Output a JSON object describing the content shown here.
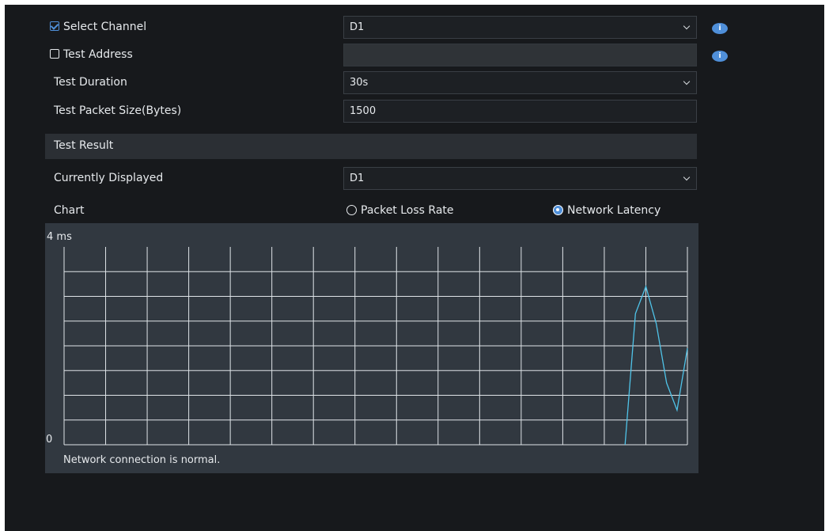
{
  "form": {
    "select_channel_label": "Select Channel",
    "select_channel_checked": true,
    "select_channel_value": "D1",
    "test_address_label": "Test Address",
    "test_address_checked": false,
    "test_address_value": "",
    "test_duration_label": "Test Duration",
    "test_duration_value": "30s",
    "packet_size_label": "Test Packet Size(Bytes)",
    "packet_size_value": "1500",
    "info_icon": "info-icon"
  },
  "result": {
    "section_title": "Test Result",
    "currently_displayed_label": "Currently Displayed",
    "currently_displayed_value": "D1",
    "chart_label": "Chart",
    "option_loss": "Packet Loss Rate",
    "option_latency": "Network Latency",
    "selected_option": "Network Latency",
    "status_text": "Network connection is normal."
  },
  "colors": {
    "accent": "#4f8fd9",
    "line": "#4fc3e8",
    "grid": "#dfe4e8",
    "panel": "#17191c",
    "chart_bg": "#313840"
  },
  "chart_data": {
    "type": "line",
    "ymax_label": "4 ms",
    "ymin_label": "0",
    "ylim": [
      0,
      4
    ],
    "xlim": [
      0,
      30
    ],
    "grid": true,
    "series": [
      {
        "x": [
          27.0,
          27.5,
          28.0,
          28.5,
          29.0,
          29.5,
          30.0
        ],
        "y": [
          0.0,
          2.65,
          3.2,
          2.45,
          1.25,
          0.7,
          1.95
        ]
      }
    ]
  }
}
